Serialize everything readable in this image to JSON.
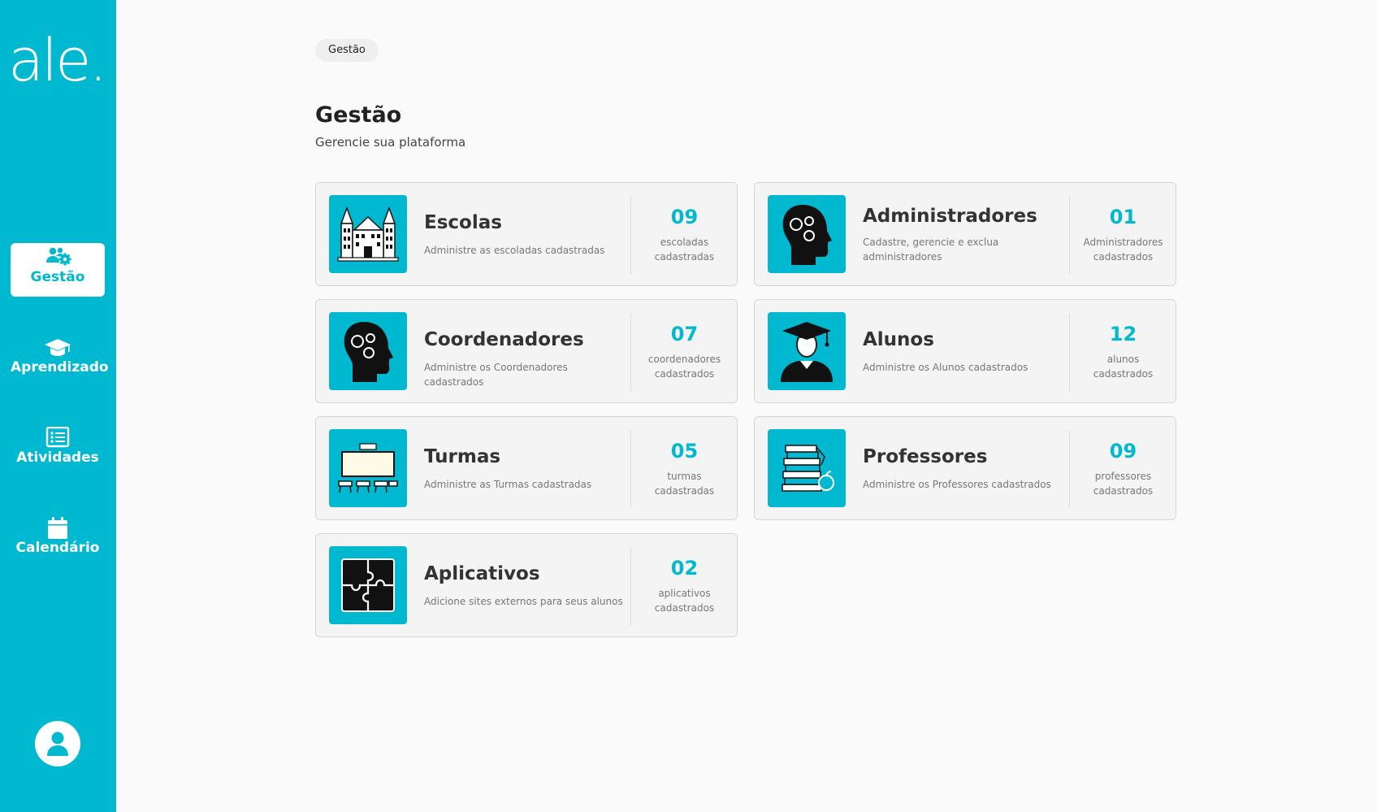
{
  "sidebar": {
    "logo": "ale.",
    "items": [
      {
        "label": "Gestão",
        "icon": "users-gear-icon",
        "active": true
      },
      {
        "label": "Aprendizado",
        "icon": "graduation-cap-icon",
        "active": false
      },
      {
        "label": "Atividades",
        "icon": "list-icon",
        "active": false
      },
      {
        "label": "Calendário",
        "icon": "calendar-icon",
        "active": false
      }
    ],
    "avatar_icon": "user-icon"
  },
  "breadcrumb": "Gestão",
  "page": {
    "title": "Gestão",
    "subtitle": "Gerencie sua plataforma"
  },
  "cards": [
    {
      "title": "Escolas",
      "description": "Administre as escoladas cadastradas",
      "count": "09",
      "count_line1": "escoladas",
      "count_line2": "cadastradas",
      "icon": "school-building-icon"
    },
    {
      "title": "Administradores",
      "description": "Cadastre, gerencie e exclua administradores",
      "count": "01",
      "count_line1": "Administradores",
      "count_line2": "cadastrados",
      "icon": "head-gears-icon"
    },
    {
      "title": "Coordenadores",
      "description": "Administre os Coordenadores cadastrados",
      "count": "07",
      "count_line1": "coordenadores",
      "count_line2": "cadastrados",
      "icon": "head-gears-icon"
    },
    {
      "title": "Alunos",
      "description": "Administre os Alunos cadastrados",
      "count": "12",
      "count_line1": "alunos",
      "count_line2": "cadastrados",
      "icon": "graduate-student-icon"
    },
    {
      "title": "Turmas",
      "description": "Administre as Turmas cadastradas",
      "count": "05",
      "count_line1": "turmas",
      "count_line2": "cadastradas",
      "icon": "classroom-icon"
    },
    {
      "title": "Professores",
      "description": "Administre os Professores cadastrados",
      "count": "09",
      "count_line1": "professores",
      "count_line2": "cadastrados",
      "icon": "books-apple-icon"
    },
    {
      "title": "Aplicativos",
      "description": "Adicione sites externos para seus alunos",
      "count": "02",
      "count_line1": "aplicativos",
      "count_line2": "cadastrados",
      "icon": "puzzle-icon"
    }
  ],
  "colors": {
    "accent": "#00b9d1",
    "background": "#fafafa",
    "card": "#f4f4f4"
  }
}
